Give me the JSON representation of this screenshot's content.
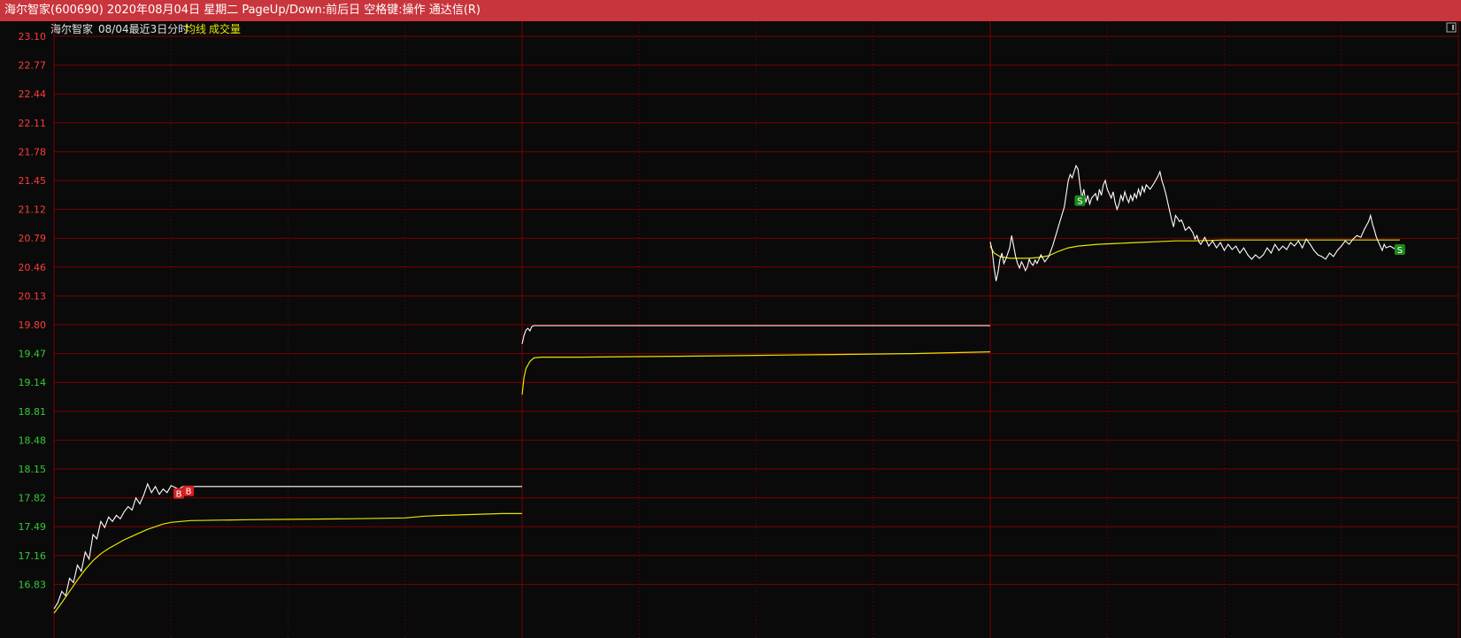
{
  "window": {
    "title": "海尔智家(600690) 2020年08月04日 星期二 PageUp/Down:前后日 空格键:操作 通达信(R)"
  },
  "header": {
    "stock_name": "海尔智家",
    "period_label": "08/04最近3日分时",
    "avg_line_label": "均线",
    "volume_label": "成交量"
  },
  "colors": {
    "background": "#0a0a0a",
    "title_bar": "#c9353c",
    "grid": "#7a0000",
    "price_line": "#ffffff",
    "avg_line": "#e6e600",
    "axis_up": "#ff3b3b",
    "axis_down": "#33cc33",
    "buy_marker": "#d42020",
    "sell_marker": "#1b8a1b"
  },
  "chart_data": {
    "type": "line",
    "x": "minute-of-session (0-240) per day, 3 days",
    "ylim": [
      16.5,
      23.1
    ],
    "y_ticks": [
      23.1,
      22.77,
      22.44,
      22.11,
      21.78,
      21.45,
      21.12,
      20.79,
      20.46,
      20.13,
      19.8,
      19.47,
      19.14,
      18.81,
      18.48,
      18.15,
      17.82,
      17.49,
      17.16,
      16.83
    ],
    "reference_price": 19.8,
    "days": [
      {
        "price": [
          [
            0,
            16.55
          ],
          [
            2,
            16.62
          ],
          [
            4,
            16.75
          ],
          [
            6,
            16.7
          ],
          [
            8,
            16.9
          ],
          [
            10,
            16.85
          ],
          [
            12,
            17.05
          ],
          [
            14,
            16.98
          ],
          [
            16,
            17.2
          ],
          [
            18,
            17.12
          ],
          [
            20,
            17.4
          ],
          [
            22,
            17.35
          ],
          [
            24,
            17.55
          ],
          [
            26,
            17.48
          ],
          [
            28,
            17.6
          ],
          [
            30,
            17.55
          ],
          [
            32,
            17.62
          ],
          [
            34,
            17.58
          ],
          [
            36,
            17.66
          ],
          [
            38,
            17.72
          ],
          [
            40,
            17.68
          ],
          [
            42,
            17.82
          ],
          [
            44,
            17.75
          ],
          [
            46,
            17.85
          ],
          [
            48,
            17.98
          ],
          [
            50,
            17.88
          ],
          [
            52,
            17.95
          ],
          [
            54,
            17.86
          ],
          [
            56,
            17.92
          ],
          [
            58,
            17.88
          ],
          [
            60,
            17.96
          ],
          [
            62,
            17.94
          ],
          [
            64,
            17.92
          ],
          [
            66,
            17.95
          ],
          [
            68,
            17.94
          ],
          [
            70,
            17.95
          ],
          [
            240,
            17.95
          ]
        ],
        "avg": [
          [
            0,
            16.5
          ],
          [
            4,
            16.62
          ],
          [
            8,
            16.75
          ],
          [
            12,
            16.88
          ],
          [
            16,
            17.0
          ],
          [
            20,
            17.1
          ],
          [
            24,
            17.18
          ],
          [
            28,
            17.24
          ],
          [
            32,
            17.29
          ],
          [
            36,
            17.34
          ],
          [
            40,
            17.38
          ],
          [
            44,
            17.42
          ],
          [
            48,
            17.46
          ],
          [
            52,
            17.49
          ],
          [
            56,
            17.52
          ],
          [
            60,
            17.54
          ],
          [
            70,
            17.56
          ],
          [
            100,
            17.57
          ],
          [
            150,
            17.58
          ],
          [
            180,
            17.59
          ],
          [
            190,
            17.61
          ],
          [
            200,
            17.62
          ],
          [
            215,
            17.63
          ],
          [
            230,
            17.64
          ],
          [
            240,
            17.64
          ]
        ]
      },
      {
        "price": [
          [
            0,
            19.58
          ],
          [
            1,
            19.68
          ],
          [
            2,
            19.74
          ],
          [
            3,
            19.76
          ],
          [
            4,
            19.73
          ],
          [
            5,
            19.78
          ],
          [
            6,
            19.79
          ],
          [
            8,
            19.79
          ],
          [
            240,
            19.79
          ]
        ],
        "avg": [
          [
            0,
            19.0
          ],
          [
            1,
            19.2
          ],
          [
            2,
            19.3
          ],
          [
            4,
            19.38
          ],
          [
            6,
            19.42
          ],
          [
            10,
            19.43
          ],
          [
            30,
            19.43
          ],
          [
            80,
            19.44
          ],
          [
            120,
            19.45
          ],
          [
            160,
            19.46
          ],
          [
            200,
            19.47
          ],
          [
            220,
            19.48
          ],
          [
            240,
            19.49
          ]
        ]
      },
      {
        "price": [
          [
            0,
            20.75
          ],
          [
            1,
            20.65
          ],
          [
            2,
            20.45
          ],
          [
            3,
            20.3
          ],
          [
            4,
            20.4
          ],
          [
            5,
            20.55
          ],
          [
            6,
            20.62
          ],
          [
            7,
            20.5
          ],
          [
            8,
            20.55
          ],
          [
            10,
            20.68
          ],
          [
            11,
            20.82
          ],
          [
            12,
            20.7
          ],
          [
            13,
            20.58
          ],
          [
            14,
            20.5
          ],
          [
            15,
            20.45
          ],
          [
            16,
            20.52
          ],
          [
            17,
            20.48
          ],
          [
            18,
            20.42
          ],
          [
            19,
            20.46
          ],
          [
            20,
            20.55
          ],
          [
            21,
            20.5
          ],
          [
            22,
            20.48
          ],
          [
            23,
            20.54
          ],
          [
            24,
            20.5
          ],
          [
            25,
            20.55
          ],
          [
            26,
            20.6
          ],
          [
            28,
            20.52
          ],
          [
            30,
            20.58
          ],
          [
            32,
            20.7
          ],
          [
            34,
            20.85
          ],
          [
            36,
            21.0
          ],
          [
            38,
            21.15
          ],
          [
            39,
            21.3
          ],
          [
            40,
            21.45
          ],
          [
            41,
            21.52
          ],
          [
            42,
            21.48
          ],
          [
            43,
            21.55
          ],
          [
            44,
            21.62
          ],
          [
            45,
            21.58
          ],
          [
            46,
            21.4
          ],
          [
            47,
            21.25
          ],
          [
            48,
            21.35
          ],
          [
            49,
            21.2
          ],
          [
            50,
            21.28
          ],
          [
            51,
            21.18
          ],
          [
            52,
            21.25
          ],
          [
            54,
            21.3
          ],
          [
            55,
            21.22
          ],
          [
            56,
            21.35
          ],
          [
            57,
            21.28
          ],
          [
            58,
            21.4
          ],
          [
            59,
            21.45
          ],
          [
            60,
            21.35
          ],
          [
            61,
            21.3
          ],
          [
            62,
            21.25
          ],
          [
            63,
            21.32
          ],
          [
            64,
            21.2
          ],
          [
            65,
            21.12
          ],
          [
            66,
            21.18
          ],
          [
            67,
            21.28
          ],
          [
            68,
            21.22
          ],
          [
            69,
            21.32
          ],
          [
            70,
            21.25
          ],
          [
            71,
            21.2
          ],
          [
            72,
            21.28
          ],
          [
            73,
            21.22
          ],
          [
            74,
            21.3
          ],
          [
            75,
            21.25
          ],
          [
            76,
            21.35
          ],
          [
            77,
            21.28
          ],
          [
            78,
            21.38
          ],
          [
            79,
            21.32
          ],
          [
            80,
            21.4
          ],
          [
            82,
            21.35
          ],
          [
            84,
            21.42
          ],
          [
            86,
            21.5
          ],
          [
            87,
            21.55
          ],
          [
            88,
            21.45
          ],
          [
            89,
            21.38
          ],
          [
            90,
            21.3
          ],
          [
            91,
            21.2
          ],
          [
            92,
            21.1
          ],
          [
            93,
            21.0
          ],
          [
            94,
            20.92
          ],
          [
            95,
            21.05
          ],
          [
            96,
            21.02
          ],
          [
            97,
            20.98
          ],
          [
            98,
            21.0
          ],
          [
            99,
            20.95
          ],
          [
            100,
            20.88
          ],
          [
            102,
            20.92
          ],
          [
            104,
            20.85
          ],
          [
            105,
            20.78
          ],
          [
            106,
            20.82
          ],
          [
            107,
            20.75
          ],
          [
            108,
            20.72
          ],
          [
            110,
            20.8
          ],
          [
            112,
            20.7
          ],
          [
            114,
            20.76
          ],
          [
            116,
            20.68
          ],
          [
            118,
            20.74
          ],
          [
            120,
            20.65
          ],
          [
            122,
            20.72
          ],
          [
            124,
            20.66
          ],
          [
            126,
            20.7
          ],
          [
            128,
            20.62
          ],
          [
            130,
            20.68
          ],
          [
            132,
            20.6
          ],
          [
            134,
            20.55
          ],
          [
            136,
            20.6
          ],
          [
            138,
            20.56
          ],
          [
            140,
            20.6
          ],
          [
            142,
            20.68
          ],
          [
            144,
            20.62
          ],
          [
            146,
            20.72
          ],
          [
            148,
            20.65
          ],
          [
            150,
            20.7
          ],
          [
            152,
            20.66
          ],
          [
            154,
            20.74
          ],
          [
            156,
            20.7
          ],
          [
            158,
            20.76
          ],
          [
            160,
            20.68
          ],
          [
            162,
            20.78
          ],
          [
            164,
            20.72
          ],
          [
            166,
            20.65
          ],
          [
            168,
            20.6
          ],
          [
            170,
            20.58
          ],
          [
            172,
            20.55
          ],
          [
            174,
            20.62
          ],
          [
            176,
            20.58
          ],
          [
            178,
            20.65
          ],
          [
            180,
            20.7
          ],
          [
            182,
            20.76
          ],
          [
            184,
            20.72
          ],
          [
            186,
            20.78
          ],
          [
            188,
            20.82
          ],
          [
            190,
            20.8
          ],
          [
            192,
            20.9
          ],
          [
            194,
            20.98
          ],
          [
            195,
            21.05
          ],
          [
            196,
            20.95
          ],
          [
            197,
            20.88
          ],
          [
            198,
            20.8
          ],
          [
            199,
            20.75
          ],
          [
            200,
            20.7
          ],
          [
            201,
            20.65
          ],
          [
            202,
            20.72
          ],
          [
            203,
            20.68
          ],
          [
            205,
            20.7
          ],
          [
            208,
            20.66
          ],
          [
            210,
            20.68
          ]
        ],
        "avg": [
          [
            0,
            20.7
          ],
          [
            2,
            20.62
          ],
          [
            5,
            20.58
          ],
          [
            10,
            20.56
          ],
          [
            20,
            20.56
          ],
          [
            25,
            20.57
          ],
          [
            30,
            20.59
          ],
          [
            35,
            20.64
          ],
          [
            40,
            20.68
          ],
          [
            45,
            20.7
          ],
          [
            55,
            20.72
          ],
          [
            65,
            20.73
          ],
          [
            75,
            20.74
          ],
          [
            85,
            20.75
          ],
          [
            95,
            20.76
          ],
          [
            105,
            20.76
          ],
          [
            120,
            20.77
          ],
          [
            140,
            20.77
          ],
          [
            160,
            20.77
          ],
          [
            180,
            20.77
          ],
          [
            200,
            20.77
          ],
          [
            210,
            20.77
          ]
        ]
      }
    ],
    "signals": [
      {
        "label": "B",
        "day": 0,
        "minute": 64,
        "price": 17.87
      },
      {
        "label": "B",
        "day": 0,
        "minute": 69,
        "price": 17.9
      },
      {
        "label": "S",
        "day": 2,
        "minute": 46,
        "price": 21.22
      },
      {
        "label": "S",
        "day": 2,
        "minute": 210,
        "price": 20.66
      }
    ]
  }
}
